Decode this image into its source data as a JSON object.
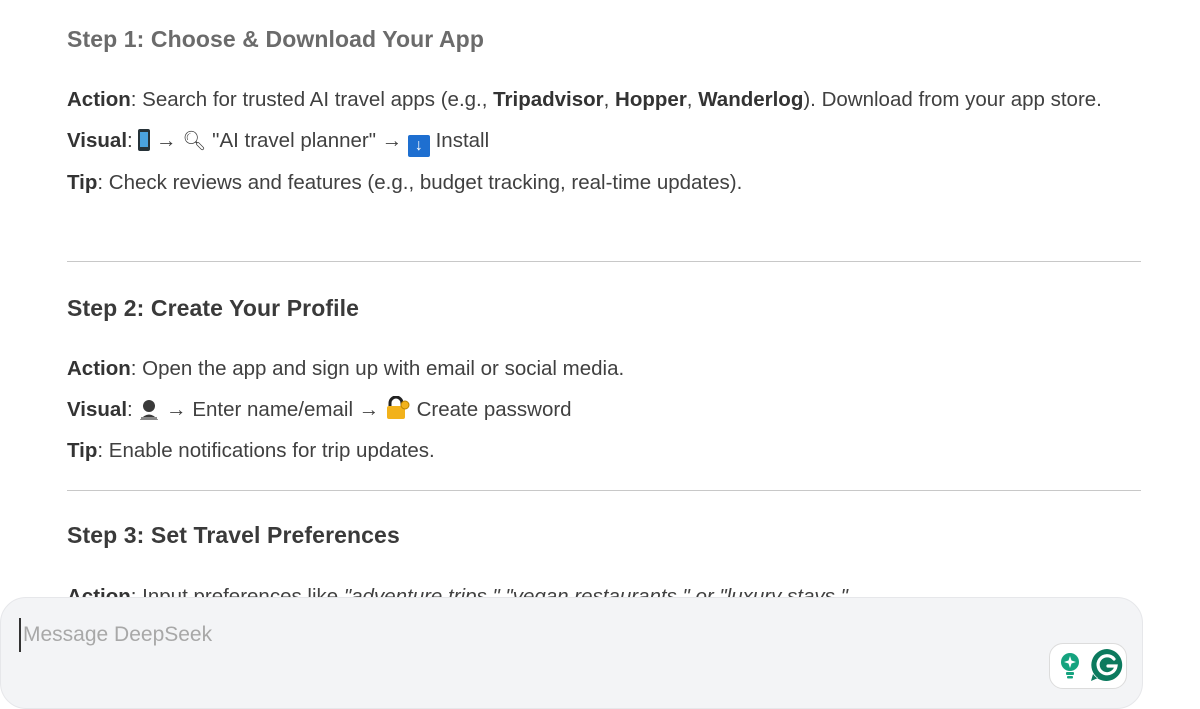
{
  "steps": [
    {
      "heading": "Step 1: Choose & Download Your App",
      "action_label": "Action",
      "action_text_1": ": Search for trusted AI travel apps (e.g., ",
      "apps": [
        "Tripadvisor",
        "Hopper",
        "Wanderlog"
      ],
      "action_text_2": "). Download from your app store.",
      "visual_label": "Visual",
      "visual_parts": [
        "→",
        "\"AI travel planner\" →",
        "Install"
      ],
      "visual_icons": [
        "mobile-phone-icon",
        "magnifier-icon",
        "download-arrow-icon"
      ],
      "tip_label": "Tip",
      "tip_text": ": Check reviews and features (e.g., budget tracking, real-time updates)."
    },
    {
      "heading": "Step 2: Create Your Profile",
      "action_label": "Action",
      "action_text": ": Open the app and sign up with email or social media.",
      "visual_label": "Visual",
      "visual_parts": [
        "→ Enter name/email →",
        "Create password"
      ],
      "visual_icons": [
        "user-silhouette-icon",
        "lock-with-key-icon"
      ],
      "tip_label": "Tip",
      "tip_text": ": Enable notifications for trip updates."
    },
    {
      "heading": "Step 3: Set Travel Preferences",
      "action_label": "Action",
      "action_text_1": ": Input preferences like ",
      "action_italic": "\"adventure trips,\" \"vegan restaurants,\" or \"luxury stays.\""
    }
  ],
  "composer": {
    "placeholder": "Message DeepSeek",
    "value": ""
  },
  "extensions": {
    "icons": [
      "lightbulb-sparkle-icon",
      "grammarly-icon"
    ],
    "accent": "#15a37f",
    "grammarly_color": "#0c7a5e"
  }
}
